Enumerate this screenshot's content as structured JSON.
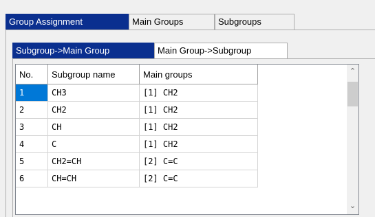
{
  "top_tabs": [
    "Group Assignment",
    "Main Groups",
    "Subgroups"
  ],
  "sub_tabs": [
    "Subgroup->Main Group",
    "Main Group->Subgroup"
  ],
  "table": {
    "columns": [
      "No.",
      "Subgroup name",
      "Main groups"
    ],
    "rows": [
      [
        "1",
        "CH3",
        "[1] CH2"
      ],
      [
        "2",
        "CH2",
        "[1] CH2"
      ],
      [
        "3",
        "CH",
        "[1] CH2"
      ],
      [
        "4",
        "C",
        "[1] CH2"
      ],
      [
        "5",
        "CH2=CH",
        "[2] C=C"
      ],
      [
        "6",
        "CH=CH",
        "[2] C=C"
      ]
    ]
  },
  "selected_row": 1,
  "icons": {
    "scroll_up": "chevron-up-icon",
    "scroll_down": "chevron-down-icon"
  },
  "colors": {
    "active_tab": "#0a2f8f",
    "selection": "#0078d7"
  }
}
